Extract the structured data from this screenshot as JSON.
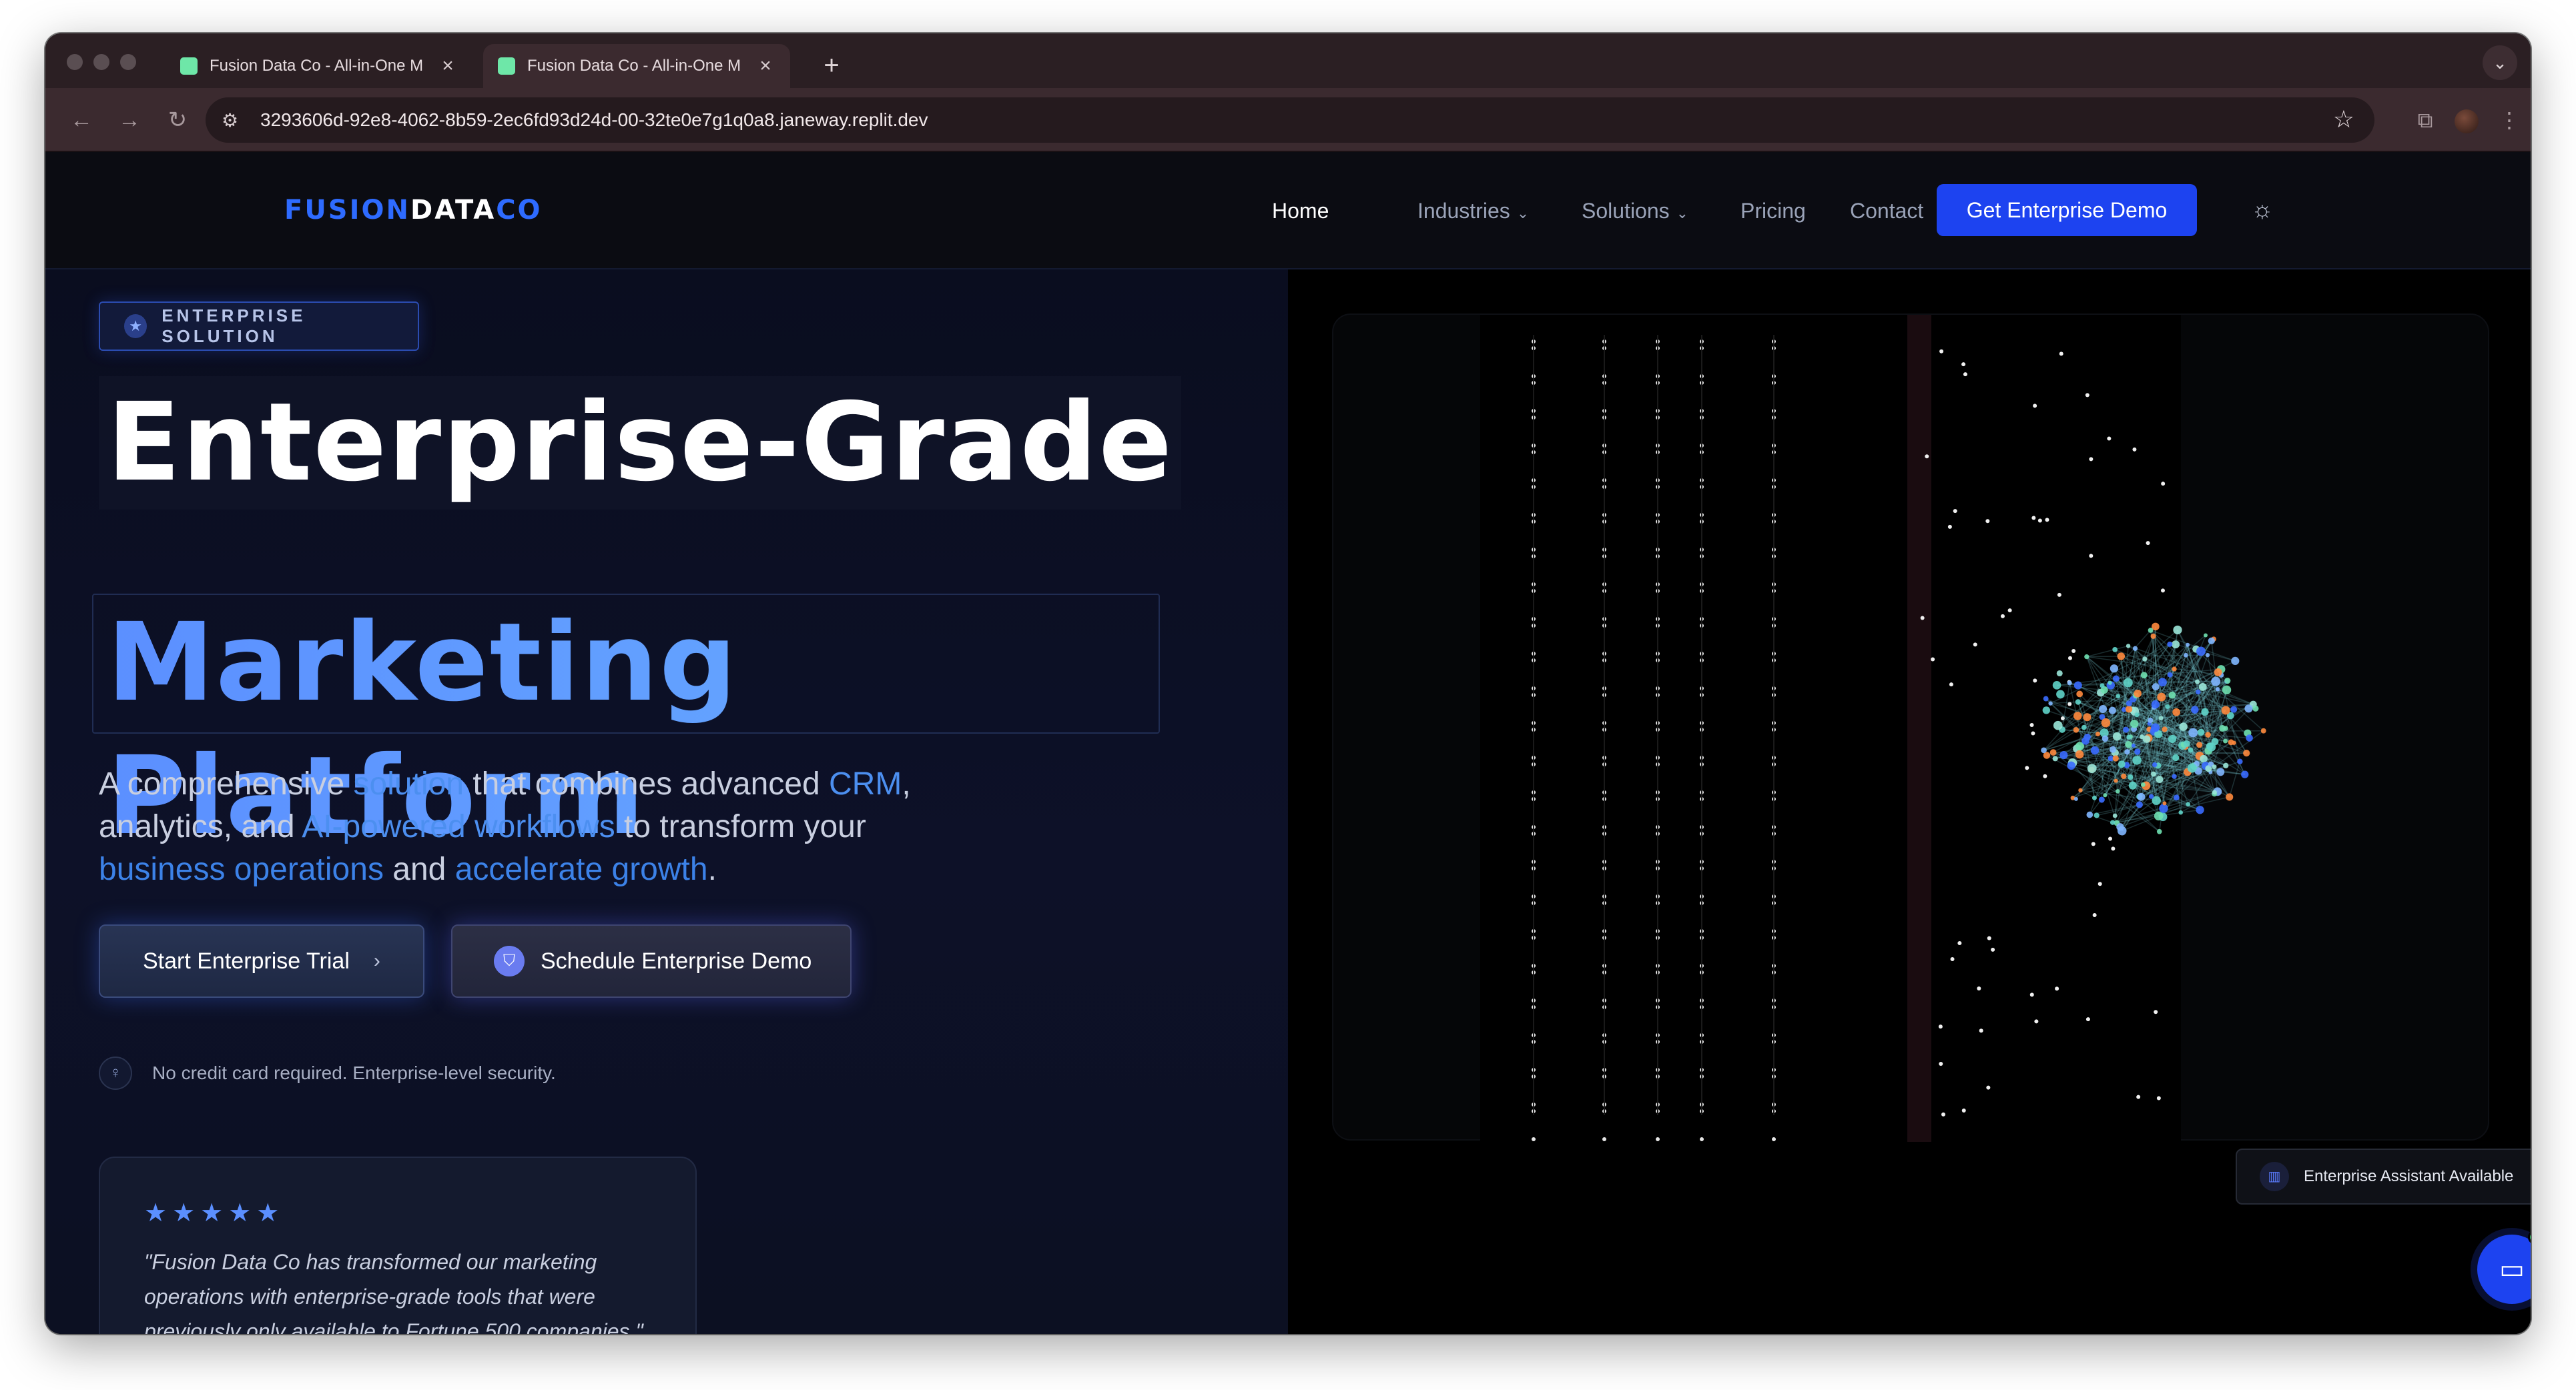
{
  "browser": {
    "tabs": [
      {
        "title": "Fusion Data Co - All-in-One M"
      },
      {
        "title": "Fusion Data Co - All-in-One M"
      }
    ],
    "new_tab": "+",
    "url": "3293606d-92e8-4062-8b59-2ec6fd93d24d-00-32te0e7g1q0a8.janeway.replit.dev"
  },
  "nav": {
    "logo_a": "FUSION",
    "logo_b": "DATA",
    "logo_c": "CO",
    "links": [
      "Home",
      "Industries",
      "Solutions",
      "Pricing",
      "Contact"
    ],
    "cta": "Get Enterprise Demo"
  },
  "hero": {
    "badge": "ENTERPRISE SOLUTION",
    "title_line1": "Enterprise-Grade",
    "title_line2": "Marketing Platform",
    "lead": {
      "p1": "A comprehensive ",
      "h1": "solution",
      "p2": " that combines advanced ",
      "h2": "CRM",
      "p3": ", analytics, and ",
      "h3": "AI-powered workflows",
      "p4": " to transform your ",
      "h4": "business operations",
      "p5": " and ",
      "h5": "accelerate growth",
      "p6": "."
    },
    "primary_button": "Start Enterprise Trial",
    "secondary_button": "Schedule Enterprise Demo",
    "note": "No credit card required. Enterprise-level security.",
    "testimonial": {
      "stars": "★★★★★",
      "rating": 5,
      "quote": "\"Fusion Data Co has transformed our marketing operations with enterprise-grade tools that were previously only available to Fortune 500 companies.\""
    }
  },
  "assistant": {
    "label": "Enterprise Assistant Available"
  },
  "colors": {
    "accent": "#1d43f0",
    "highlight": "#4c8ff0",
    "logo_blue": "#2e6bff"
  }
}
